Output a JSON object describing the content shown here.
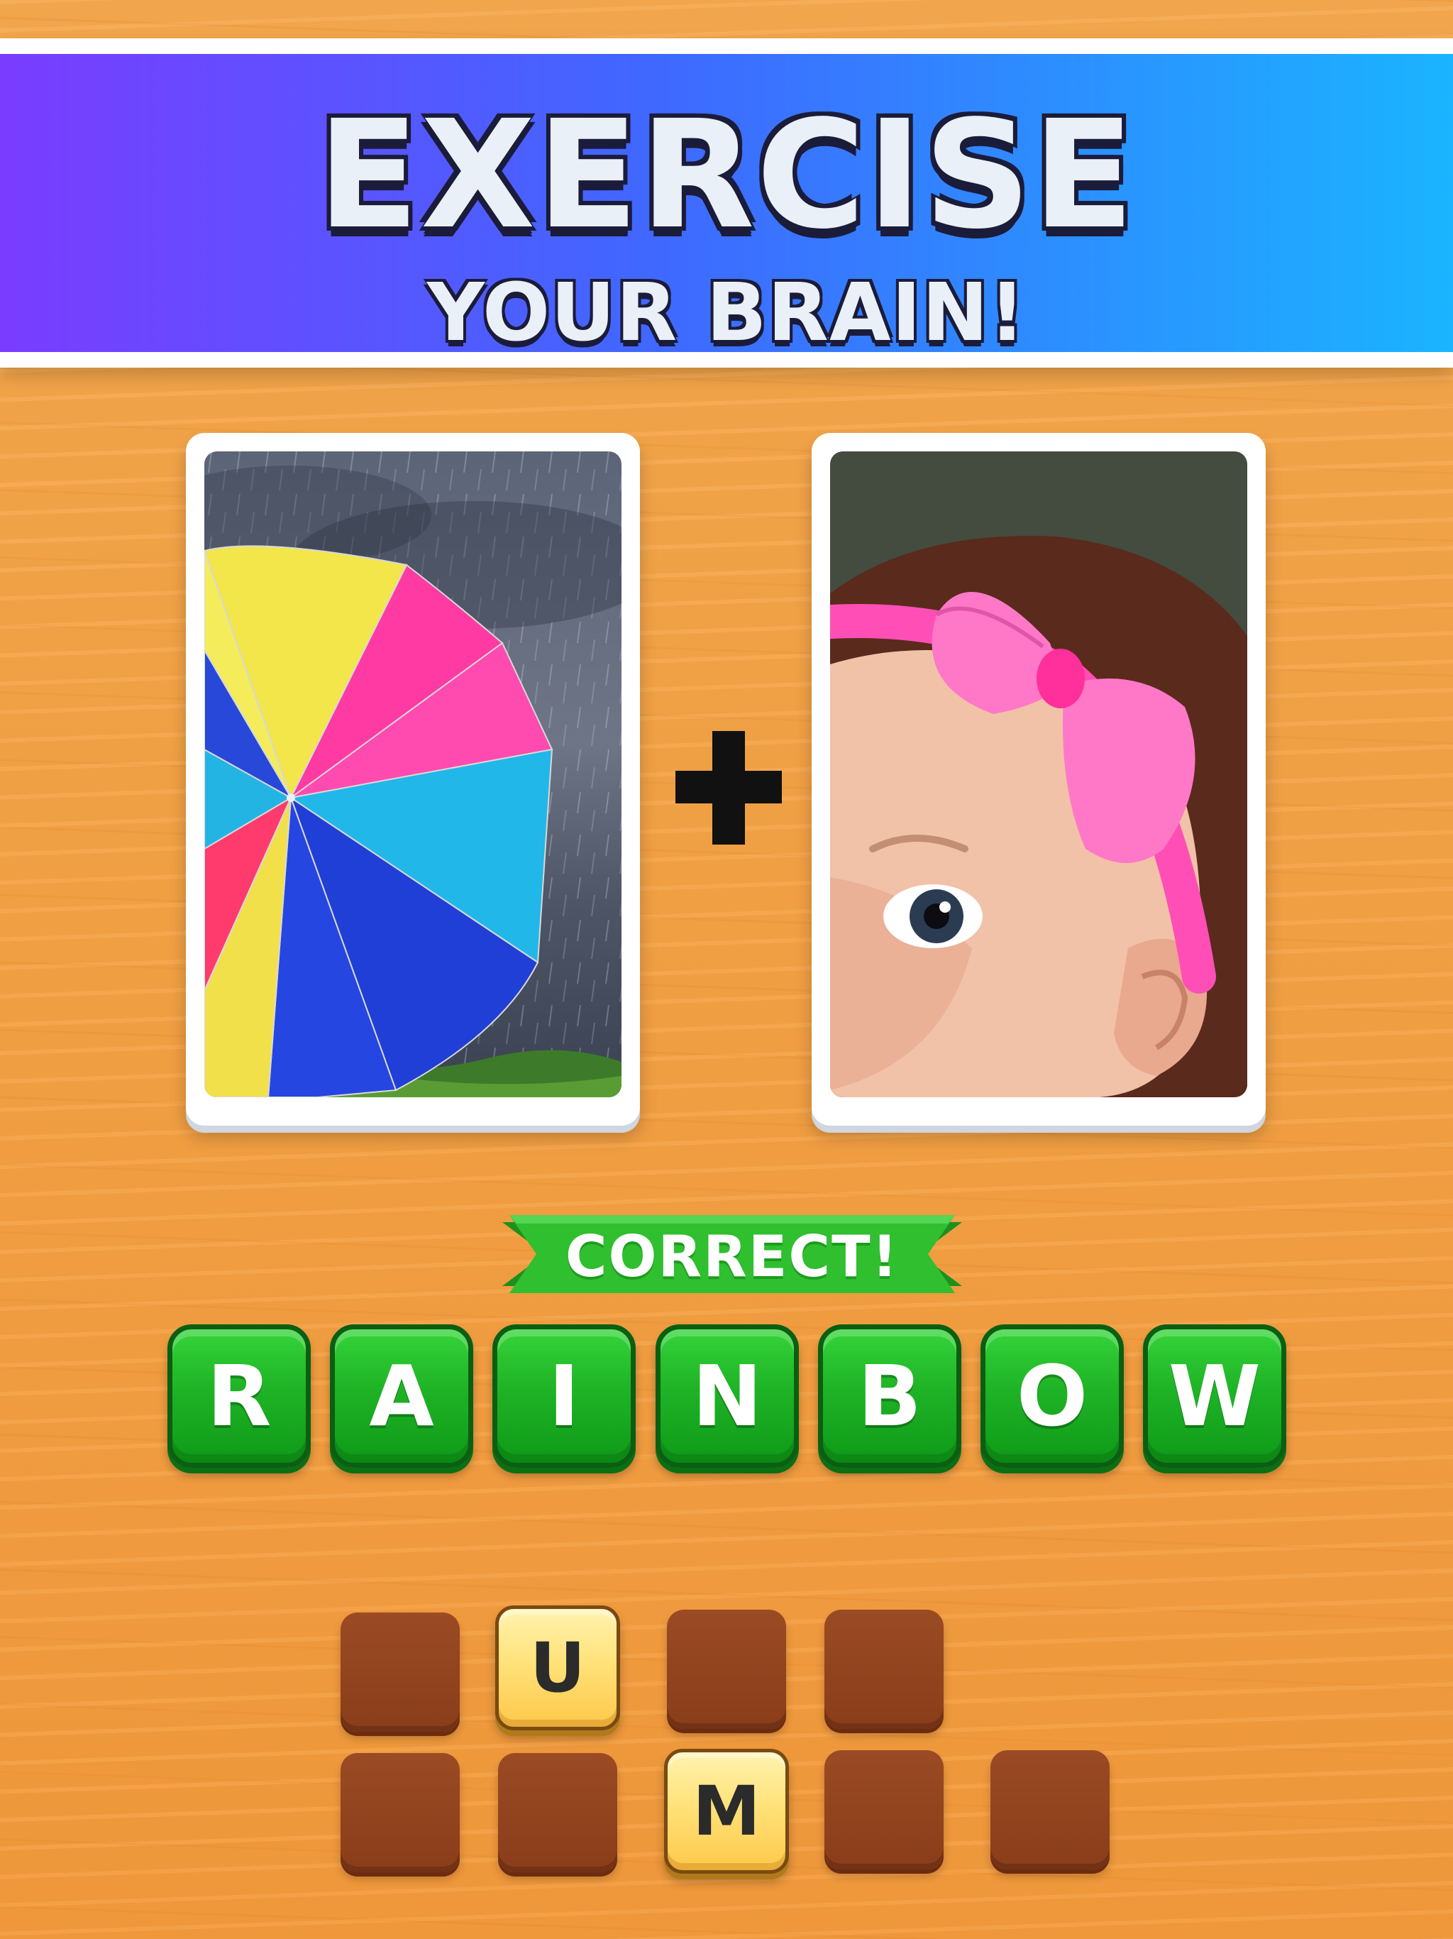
{
  "header": {
    "title": "EXERCISE",
    "subtitle": "YOUR BRAIN!"
  },
  "clue": {
    "left_image": "umbrella-photo",
    "right_image": "baby-bow-photo",
    "operator": "plus-icon"
  },
  "feedback": {
    "label": "CORRECT!",
    "color": "#2fbf2f"
  },
  "answer": {
    "letters": [
      "R",
      "A",
      "I",
      "N",
      "B",
      "O",
      "W"
    ],
    "tile_color": "#1fb326"
  },
  "letter_pool": {
    "row1": [
      "",
      "U",
      "",
      ""
    ],
    "row2": [
      "",
      "",
      "M",
      "",
      ""
    ],
    "slot_color": "#8f431d",
    "tile_color": "#ffe27a"
  }
}
